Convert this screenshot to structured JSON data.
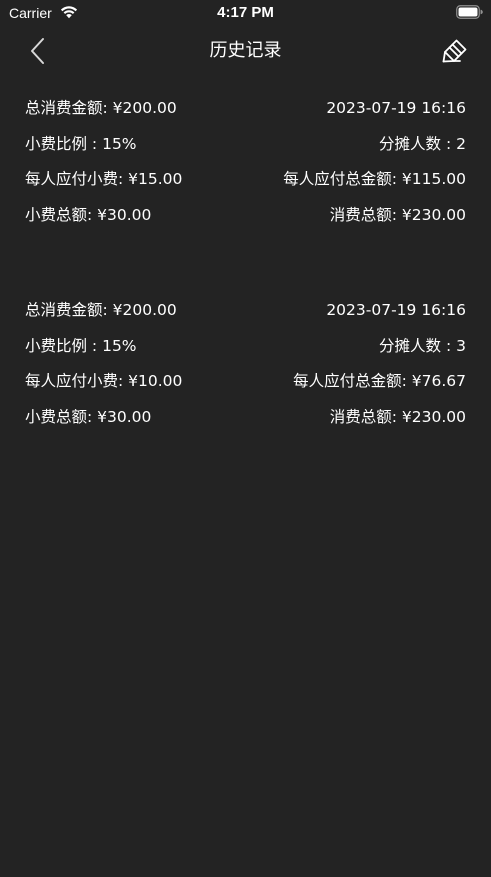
{
  "status_bar": {
    "carrier": "Carrier",
    "time": "4:17 PM"
  },
  "nav": {
    "title": "历史记录",
    "back_icon": "chevron-left-icon",
    "clear_icon": "eraser-icon"
  },
  "records": [
    {
      "total_label": "总消费金额: ¥200.00",
      "date": "2023-07-19 16:16",
      "tip_ratio": "小费比例 : 15%",
      "people": "分摊人数 : 2",
      "tip_per_person": "每人应付小费: ¥15.00",
      "total_per_person": "每人应付总金额: ¥115.00",
      "tip_total": "小费总额: ¥30.00",
      "consume_total": "消费总额: ¥230.00"
    },
    {
      "total_label": "总消费金额: ¥200.00",
      "date": "2023-07-19 16:16",
      "tip_ratio": "小费比例 : 15%",
      "people": "分摊人数 : 3",
      "tip_per_person": "每人应付小费: ¥10.00",
      "total_per_person": "每人应付总金额: ¥76.67",
      "tip_total": "小费总额: ¥30.00",
      "consume_total": "消费总额: ¥230.00"
    }
  ],
  "colors": {
    "background": "#232323",
    "text": "#ffffff"
  }
}
